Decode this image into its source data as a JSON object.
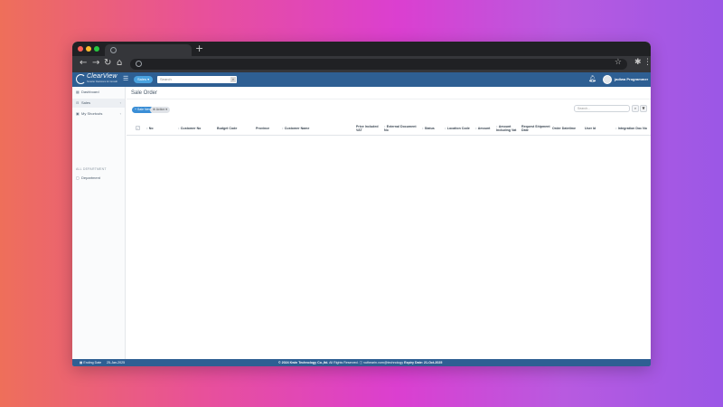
{
  "colors": {
    "brand_blue": "#2e5f93",
    "accent_blue": "#3a8ed6",
    "background_gradient": [
      "#ee6f5a",
      "#db3fd0",
      "#9b57e6"
    ]
  },
  "browser": {
    "new_tab_symbol": "+",
    "icons": [
      "back-icon",
      "forward-icon",
      "reload-icon",
      "home-icon",
      "star-icon",
      "extension-icon",
      "kebab-menu-icon"
    ]
  },
  "header": {
    "logo_name": "ClearView",
    "logo_tagline": "Smarter Decisions for Growth",
    "menu_button": "Sales ▾",
    "search_placeholder": "Search",
    "user_name": "jadiwa Programmer"
  },
  "sidebar": {
    "items": [
      {
        "label": "Dashboard",
        "icon": "dashboard-icon"
      },
      {
        "label": "Sales",
        "icon": "cart-icon",
        "chevron": "‹"
      },
      {
        "label": "My Shortcuts",
        "icon": "bookmark-icon",
        "chevron": "‹"
      }
    ],
    "section_label": "ALL DEPARTMENT",
    "section_items": [
      {
        "label": "Department",
        "icon": "document-icon"
      }
    ],
    "badge": "9"
  },
  "main": {
    "page_title": "Sale Order",
    "new_button": "+ Sale New",
    "action_button": "⊕ Action ▾",
    "search_placeholder": "Search...",
    "columns": [
      {
        "label": "No",
        "sortable": true
      },
      {
        "label": "Customer No",
        "sortable": true
      },
      {
        "label": "Budget Code",
        "sortable": false
      },
      {
        "label": "Province",
        "sortable": false
      },
      {
        "label": "Customer Name",
        "sortable": true
      },
      {
        "label": "Price Included VAT",
        "sortable": false
      },
      {
        "label": "External Document No",
        "sortable": true
      },
      {
        "label": "Status",
        "sortable": true
      },
      {
        "label": "Location Code",
        "sortable": true
      },
      {
        "label": "Amount",
        "sortable": true
      },
      {
        "label": "Amount Including Vat",
        "sortable": true
      },
      {
        "label": "Request Shipment Date",
        "sortable": false
      },
      {
        "label": "Order Datetime",
        "sortable": false
      },
      {
        "label": "User Id",
        "sortable": false
      },
      {
        "label": "Integration Doc No",
        "sortable": true
      }
    ]
  },
  "footer": {
    "ending_label": "Ending Date",
    "ending_date": "25-Jan-2025",
    "copyright": "© 2024 Kwin Technology Co.,ltd.",
    "rights": "All Rights Reserved. ⓘ vuthearin.vorn@technology",
    "expiry": "Expiry Date: 21-Oct-2025"
  }
}
